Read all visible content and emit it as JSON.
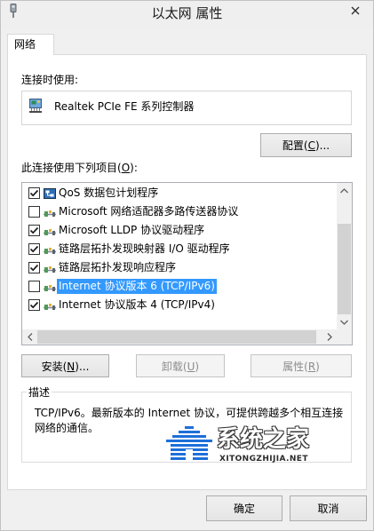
{
  "window": {
    "title": "以太网 属性",
    "title_icon": "network-connection-icon",
    "close_icon": "close-icon"
  },
  "tabs": [
    {
      "label": "网络",
      "selected": true
    }
  ],
  "connect_using": {
    "label": "连接时使用:",
    "adapter_icon": "network-adapter-icon",
    "adapter_name": "Realtek PCIe FE 系列控制器",
    "configure_button": "配置(C)..."
  },
  "components": {
    "label": "此连接使用下列项目(O):",
    "items": [
      {
        "label": "QoS 数据包计划程序",
        "checked": true,
        "icon": "qos-icon"
      },
      {
        "label": "Microsoft 网络适配器多路传送器协议",
        "checked": false,
        "icon": "protocol-icon"
      },
      {
        "label": "Microsoft LLDP 协议驱动程序",
        "checked": true,
        "icon": "protocol-icon"
      },
      {
        "label": "链路层拓扑发现映射器 I/O 驱动程序",
        "checked": true,
        "icon": "protocol-icon"
      },
      {
        "label": "链路层拓扑发现响应程序",
        "checked": true,
        "icon": "protocol-icon"
      },
      {
        "label": "Internet 协议版本 6 (TCP/IPv6)",
        "checked": false,
        "icon": "protocol-icon",
        "selected": true
      },
      {
        "label": "Internet 协议版本 4 (TCP/IPv4)",
        "checked": true,
        "icon": "protocol-icon"
      }
    ],
    "vertical_scroll": {
      "position": 1.0,
      "visible_fraction": 0.78
    },
    "horizontal_scroll": {
      "position": 0.0,
      "visible_fraction": 0.98
    }
  },
  "actions": {
    "install": {
      "label": "安装(N)...",
      "enabled": true
    },
    "uninstall": {
      "label": "卸载(U)",
      "enabled": false
    },
    "properties": {
      "label": "属性(R)",
      "enabled": false
    }
  },
  "description": {
    "title": "描述",
    "text": "TCP/IPv6。最新版本的 Internet 协议，可提供跨越多个相互连接网络的通信。"
  },
  "footer": {
    "ok": "确定",
    "cancel": "取消"
  },
  "watermark": {
    "name": "系统之家",
    "site": "XITONGZHIJIA.NET"
  },
  "colors": {
    "selection_background": "#3399ff",
    "watermark_logo": "#1e6fd9"
  }
}
